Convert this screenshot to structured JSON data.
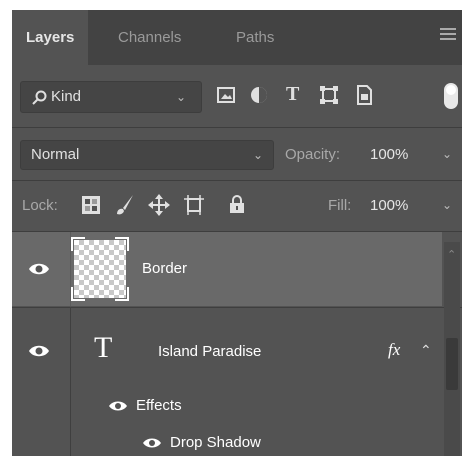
{
  "tabs": [
    {
      "label": "Layers",
      "active": true
    },
    {
      "label": "Channels",
      "active": false
    },
    {
      "label": "Paths",
      "active": false
    }
  ],
  "filter": {
    "label": "Kind",
    "icons": [
      "image-filter-icon",
      "adjustment-filter-icon",
      "type-filter-icon",
      "shape-filter-icon",
      "smart-object-filter-icon",
      "filter-toggle-icon"
    ]
  },
  "blend": {
    "mode": "Normal",
    "opacity_label": "Opacity:",
    "opacity_value": "100%"
  },
  "lock": {
    "label": "Lock:",
    "fill_label": "Fill:",
    "fill_value": "100%"
  },
  "layers": [
    {
      "name": "Border",
      "type": "pixel",
      "selected": true
    },
    {
      "name": "Island Paradise",
      "type": "text",
      "fx": "fx",
      "effects_label": "Effects",
      "effects": [
        "Drop Shadow"
      ]
    }
  ],
  "colors": {
    "panel": "#535353",
    "tabbar": "#434343",
    "selected_row": "#696969"
  }
}
